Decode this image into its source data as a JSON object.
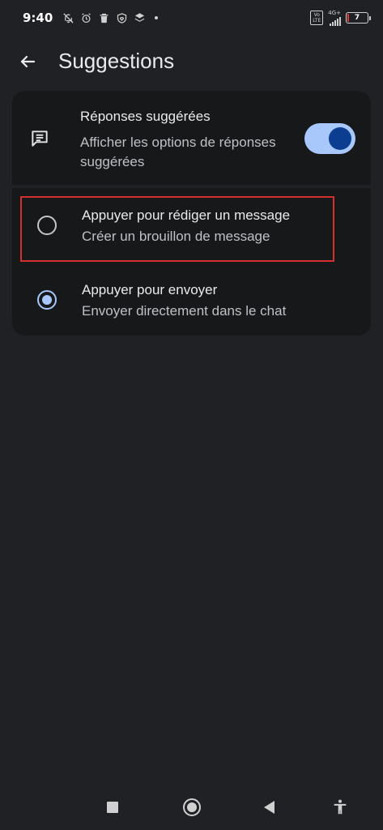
{
  "status_bar": {
    "time": "9:40",
    "volte_label": "Vo\nLTE",
    "network_label": "4G+",
    "battery_level": "7",
    "battery_fraction": 0.07,
    "icons": [
      "bell-off-icon",
      "alarm-icon",
      "trash-icon",
      "shield-heart-icon",
      "layers-icon"
    ]
  },
  "app_bar": {
    "title": "Suggestions"
  },
  "suggested_replies": {
    "title": "Réponses suggérées",
    "subtitle": "Afficher les options de réponses suggérées",
    "enabled": true
  },
  "options": [
    {
      "title": "Appuyer pour rédiger un message",
      "subtitle": "Créer un brouillon de message",
      "selected": false
    },
    {
      "title": "Appuyer pour envoyer",
      "subtitle": "Envoyer directement dans le chat",
      "selected": true
    }
  ],
  "colors": {
    "background": "#202124",
    "card": "#17181a",
    "accent": "#a8c7fa",
    "toggle_knob": "#0b3d91",
    "highlight": "#d32f2f"
  }
}
